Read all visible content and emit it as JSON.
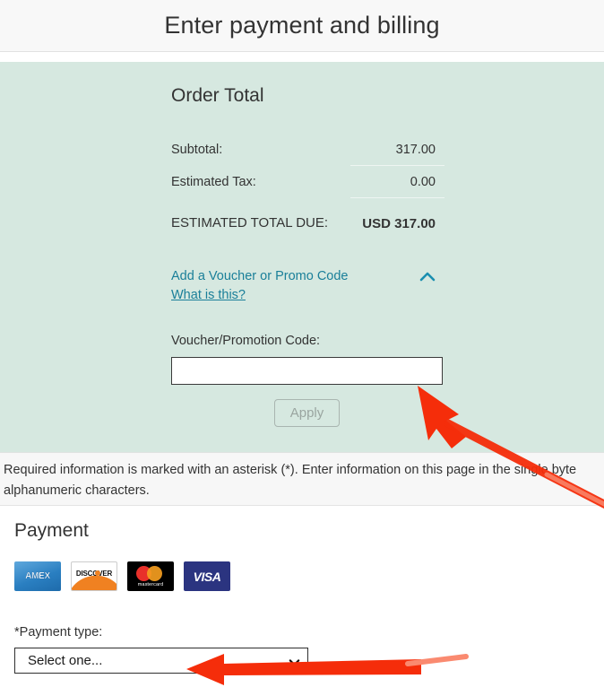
{
  "header": {
    "title": "Enter payment and billing"
  },
  "order_summary": {
    "title": "Order Total",
    "rows": [
      {
        "label": "Subtotal:",
        "value": "317.00"
      },
      {
        "label": "Estimated Tax:",
        "value": "0.00"
      }
    ],
    "total_row": {
      "label": "ESTIMATED TOTAL DUE:",
      "value": "USD 317.00"
    }
  },
  "voucher": {
    "toggle_label": "Add a Voucher or Promo Code",
    "what_is_this": "What is this?",
    "collapse_icon": "chevron-up-icon",
    "field_label": "Voucher/Promotion Code:",
    "input_value": "",
    "input_placeholder": "",
    "apply_label": "Apply"
  },
  "notice": {
    "text": "Required information is marked with an asterisk (*). Enter information on this page in the single byte alphanumeric characters."
  },
  "payment": {
    "title": "Payment",
    "accepted_cards": [
      {
        "name": "amex-card-logo",
        "label": "AMEX"
      },
      {
        "name": "discover-card-logo",
        "label": "DISCOVER"
      },
      {
        "name": "mastercard-card-logo",
        "label": "mastercard"
      },
      {
        "name": "visa-card-logo",
        "label": "VISA"
      }
    ],
    "payment_type_label": "*Payment type:",
    "payment_type_value": "Select one...",
    "payment_type_options": [
      "Select one..."
    ],
    "dropdown_icon": "chevron-down-icon"
  },
  "colors": {
    "summary_panel_bg": "#d6e8e0",
    "link_teal": "#1a7f99",
    "annotation_red": "#f52d0a",
    "notice_bg": "#f7f7f7"
  }
}
